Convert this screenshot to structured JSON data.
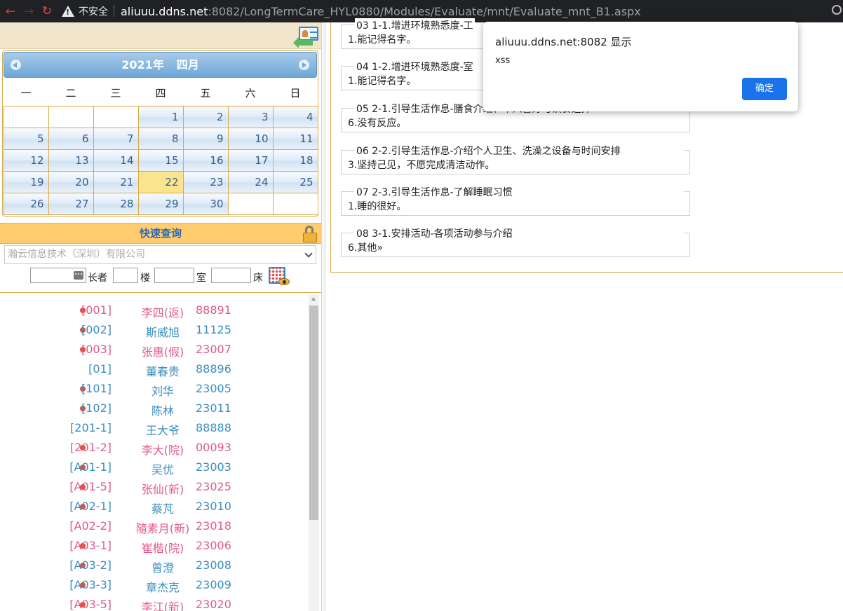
{
  "browser": {
    "security_label": "不安全",
    "url_host": "aliuuu.ddns.net",
    "url_path": ":8082/LongTermCare_HYL0880/Modules/Evaluate/mnt/Evaluate_mnt_B1.aspx"
  },
  "calendar": {
    "year_label": "2021年",
    "month_label": "四月",
    "weekdays": [
      "一",
      "二",
      "三",
      "四",
      "五",
      "六",
      "日"
    ],
    "days": [
      "",
      "",
      "",
      "1",
      "2",
      "3",
      "4",
      "5",
      "6",
      "7",
      "8",
      "9",
      "10",
      "11",
      "12",
      "13",
      "14",
      "15",
      "16",
      "17",
      "18",
      "19",
      "20",
      "21",
      "22",
      "23",
      "24",
      "25",
      "26",
      "27",
      "28",
      "29",
      "30",
      "",
      ""
    ],
    "today": "22"
  },
  "quick_search": {
    "title": "快速查询",
    "org_selected": "瀚云信息技术（深圳）有限公司",
    "label_elder": "长者",
    "label_floor": "楼",
    "label_room": "室",
    "label_bed": "床"
  },
  "residents": [
    {
      "room": "[001]",
      "name": "李四(返)",
      "id": "88891",
      "dot": true,
      "color": "pink"
    },
    {
      "room": "[002]",
      "name": "斯威旭",
      "id": "11125",
      "dot": true,
      "color": "blue"
    },
    {
      "room": "[003]",
      "name": "张惠(假)",
      "id": "23007",
      "dot": true,
      "color": "pink"
    },
    {
      "room": "[01]",
      "name": "董春贵",
      "id": "88896",
      "dot": false,
      "color": "blue"
    },
    {
      "room": "[101]",
      "name": "刘华",
      "id": "23005",
      "dot": true,
      "color": "blue"
    },
    {
      "room": "[102]",
      "name": "陈林",
      "id": "23011",
      "dot": true,
      "color": "blue"
    },
    {
      "room": "[201-1]",
      "name": "王大爷",
      "id": "88888",
      "dot": false,
      "color": "blue"
    },
    {
      "room": "[201-2]",
      "name": "李大(院)",
      "id": "00093",
      "dot": true,
      "color": "pink"
    },
    {
      "room": "[A01-1]",
      "name": "吴优",
      "id": "23003",
      "dot": true,
      "color": "blue"
    },
    {
      "room": "[A01-5]",
      "name": "张仙(新)",
      "id": "23025",
      "dot": true,
      "color": "pink"
    },
    {
      "room": "[A02-1]",
      "name": "蔡芃",
      "id": "23010",
      "dot": true,
      "color": "blue"
    },
    {
      "room": "[A02-2]",
      "name": "隨素月(新)",
      "id": "23018",
      "dot": false,
      "color": "pink"
    },
    {
      "room": "[A03-1]",
      "name": "崔楷(院)",
      "id": "23006",
      "dot": true,
      "color": "pink"
    },
    {
      "room": "[A03-2]",
      "name": "曾澄",
      "id": "23008",
      "dot": true,
      "color": "blue"
    },
    {
      "room": "[A03-3]",
      "name": "章杰克",
      "id": "23009",
      "dot": true,
      "color": "blue"
    },
    {
      "room": "[A03-5]",
      "name": "李江(新)",
      "id": "23020",
      "dot": true,
      "color": "pink"
    }
  ],
  "evaluations": [
    {
      "title": "03  1-1.增进环境熟悉度-工",
      "answer": "1.能记得名字。"
    },
    {
      "title": "04  1-2.增进环境熟悉度-室",
      "answer": "1.能记得名字。"
    },
    {
      "title": "05  2-1.引导生活作息-膳食介绍、个人喜好与饮食选择",
      "answer": "6.没有反应。"
    },
    {
      "title": "06  2-2.引导生活作息-介绍个人卫生、洗澡之设备与时间安排",
      "answer": "3.坚持己见，不愿完成清洁动作。"
    },
    {
      "title": "07  2-3.引导生活作息-了解睡眠习惯",
      "answer": "1.睡的很好。"
    },
    {
      "title": "08  3-1.安排活动-各项活动参与介绍",
      "answer": "6.其他»"
    }
  ],
  "alert": {
    "title": "aliuuu.ddns.net:8082 显示",
    "message": "xss",
    "ok_label": "确定"
  },
  "colors": {
    "accent_blue": "#1a73e8",
    "today_yellow": "#fbe58c",
    "panel_orange": "#ffcd6e",
    "status_dot": "#e74c3c"
  }
}
